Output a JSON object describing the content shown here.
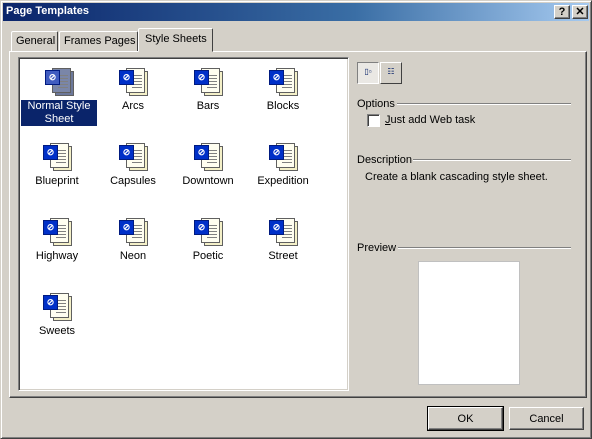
{
  "window": {
    "title": "Page Templates",
    "help_label": "?",
    "close_label": "✕"
  },
  "tabs": [
    {
      "label": "General",
      "active": false
    },
    {
      "label": "Frames Pages",
      "active": false
    },
    {
      "label": "Style Sheets",
      "active": true
    }
  ],
  "templates": [
    {
      "label": "Normal Style Sheet",
      "selected": true
    },
    {
      "label": "Arcs"
    },
    {
      "label": "Bars"
    },
    {
      "label": "Blocks"
    },
    {
      "label": "Blueprint"
    },
    {
      "label": "Capsules"
    },
    {
      "label": "Downtown"
    },
    {
      "label": "Expedition"
    },
    {
      "label": "Highway"
    },
    {
      "label": "Neon"
    },
    {
      "label": "Poetic"
    },
    {
      "label": "Street"
    },
    {
      "label": "Sweets"
    }
  ],
  "view_buttons": {
    "large_icons": "large-icons-icon",
    "details": "details-icon"
  },
  "options": {
    "heading": "Options",
    "checkbox": {
      "label_underlined": "J",
      "label_rest": "ust add Web task",
      "checked": false
    }
  },
  "description": {
    "heading": "Description",
    "text": "Create a blank cascading style sheet."
  },
  "preview": {
    "heading": "Preview"
  },
  "buttons": {
    "ok": "OK",
    "cancel": "Cancel"
  },
  "colors": {
    "titlebar": "#0a246a",
    "selection": "#0a246a",
    "face": "#d4d0c8"
  }
}
